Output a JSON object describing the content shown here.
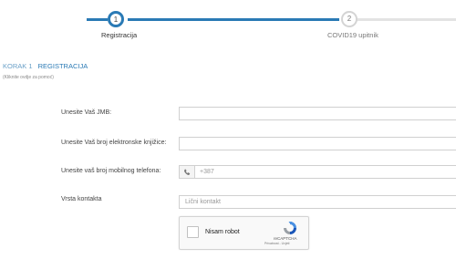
{
  "stepper": {
    "steps": [
      {
        "number": "1",
        "label": "Registracija"
      },
      {
        "number": "2",
        "label": "COVID19 upitnik"
      }
    ]
  },
  "header": {
    "step_prefix": "KORAK 1",
    "step_title": "REGISTRACIJA",
    "help": "(Kliknite ovdje za pomoć)"
  },
  "form": {
    "jmb_label": "Unesite Vaš JMB:",
    "card_label": "Unesite Vaš broj elektronske knjižice:",
    "phone_label": "Unesite vaš broj mobilnog telefona:",
    "phone_value": "+387",
    "contact_label": "Vrsta kontakta",
    "contact_value": "Lični kontakt"
  },
  "recaptcha": {
    "label": "Nisam robot",
    "brand": "reCAPTCHA",
    "terms": "Privatnost - Uvjeti"
  },
  "colors": {
    "accent": "#2a7ab5",
    "inactive": "#d4d4d4"
  }
}
